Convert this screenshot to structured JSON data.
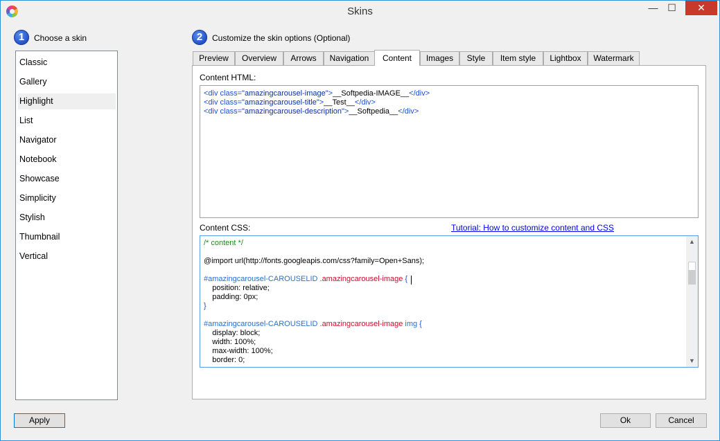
{
  "window": {
    "title": "Skins",
    "minimize": "—",
    "maximize": "☐",
    "close": "✕"
  },
  "step1": {
    "number": "1",
    "label": "Choose a skin"
  },
  "step2": {
    "number": "2",
    "label": "Customize the skin options (Optional)"
  },
  "skins": [
    "Classic",
    "Gallery",
    "Highlight",
    "List",
    "Navigator",
    "Notebook",
    "Showcase",
    "Simplicity",
    "Stylish",
    "Thumbnail",
    "Vertical"
  ],
  "selected_skin": "Highlight",
  "tabs": [
    "Preview",
    "Overview",
    "Arrows",
    "Navigation",
    "Content",
    "Images",
    "Style",
    "Item style",
    "Lightbox",
    "Watermark"
  ],
  "active_tab": "Content",
  "content_html_label": "Content HTML:",
  "content_css_label": "Content CSS:",
  "tutorial_link": "Tutorial: How to customize content and CSS",
  "html_code": {
    "line1": {
      "open": "<div ",
      "attr": "class=",
      "val": "\"amazingcarousel-image\"",
      "close": ">",
      "text": "__Softpedia-IMAGE__",
      "end_open": "</",
      "end_tag": "div",
      "end_close": ">"
    },
    "line2": {
      "open": "<div ",
      "attr": "class=",
      "val": "\"amazingcarousel-title\"",
      "close": ">",
      "text": "__Test__",
      "end_open": "</",
      "end_tag": "div",
      "end_close": ">"
    },
    "line3": {
      "open": "<div ",
      "attr": "class=",
      "val": "\"amazingcarousel-description\"",
      "close": ">",
      "text": "__Softpedia__",
      "end_open": "</",
      "end_tag": "div",
      "end_close": ">"
    }
  },
  "css_code": {
    "comment": "/* content */",
    "import": "@import url(http://fonts.googleapis.com/css?family=Open+Sans);",
    "rule1_id": "#amazingcarousel-CAROUSELID",
    "rule1_cls": " .amazingcarousel-image",
    "rule1_open": " {",
    "rule1_p1": "    position: relative;",
    "rule1_p2": "    padding: 0px;",
    "rule1_close": "}",
    "rule2_id": "#amazingcarousel-CAROUSELID",
    "rule2_cls": " .amazingcarousel-image",
    "rule2_el": " img",
    "rule2_open": " {",
    "rule2_p1": "    display: block;",
    "rule2_p2": "    width: 100%;",
    "rule2_p3": "    max-width: 100%;",
    "rule2_p4": "    border: 0;"
  },
  "buttons": {
    "apply": "Apply",
    "ok": "Ok",
    "cancel": "Cancel"
  },
  "scroll": {
    "up": "▲",
    "down": "▼"
  }
}
